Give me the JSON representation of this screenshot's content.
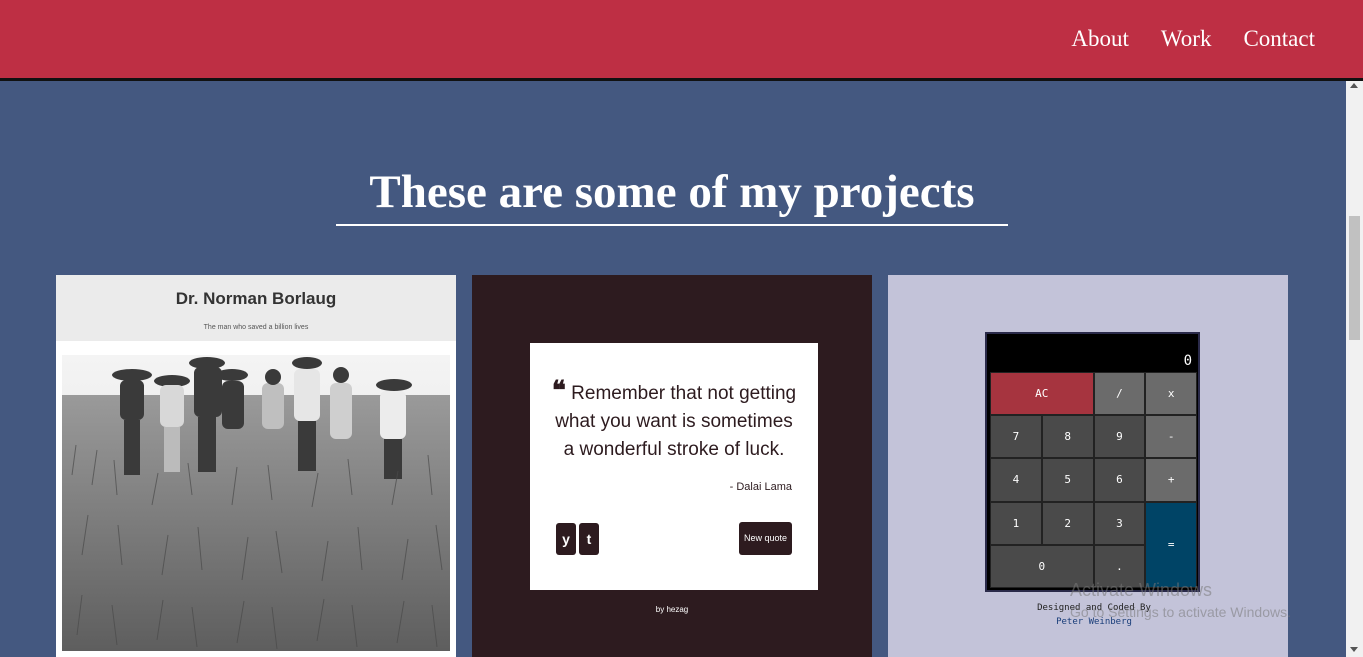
{
  "nav": {
    "links": [
      "About",
      "Work",
      "Contact"
    ]
  },
  "section": {
    "title": "These are some of my projects"
  },
  "projects": {
    "card1": {
      "title": "Dr. Norman Borlaug",
      "subtitle": "The man who saved a billion lives"
    },
    "card2": {
      "quote": "Remember that not getting what you want is sometimes a wonderful stroke of luck.",
      "quote_mark": "❝",
      "author": "- Dalai Lama",
      "twitter_icon": "twitter-icon",
      "twitter_glyph": "y",
      "tumblr_icon": "tumblr-icon",
      "tumblr_glyph": "t",
      "new_quote_label": "New quote",
      "credit": "by hezag"
    },
    "card3": {
      "display": "0",
      "keys": [
        "AC",
        "/",
        "x",
        "7",
        "8",
        "9",
        "-",
        "4",
        "5",
        "6",
        "+",
        "1",
        "2",
        "3",
        "=",
        "0",
        "."
      ],
      "credit_line": "Designed and Coded By",
      "credit_author": "Peter Weinberg"
    }
  },
  "watermark": {
    "title": "Activate Windows",
    "subtitle": "Go to Settings to activate Windows."
  },
  "colors": {
    "navbar": "#be2f44",
    "background": "#445880",
    "card2_bg": "#2d1b1f",
    "card3_bg": "#c3c3d9",
    "calc_ac": "#a6343f",
    "calc_eq": "#004466"
  }
}
